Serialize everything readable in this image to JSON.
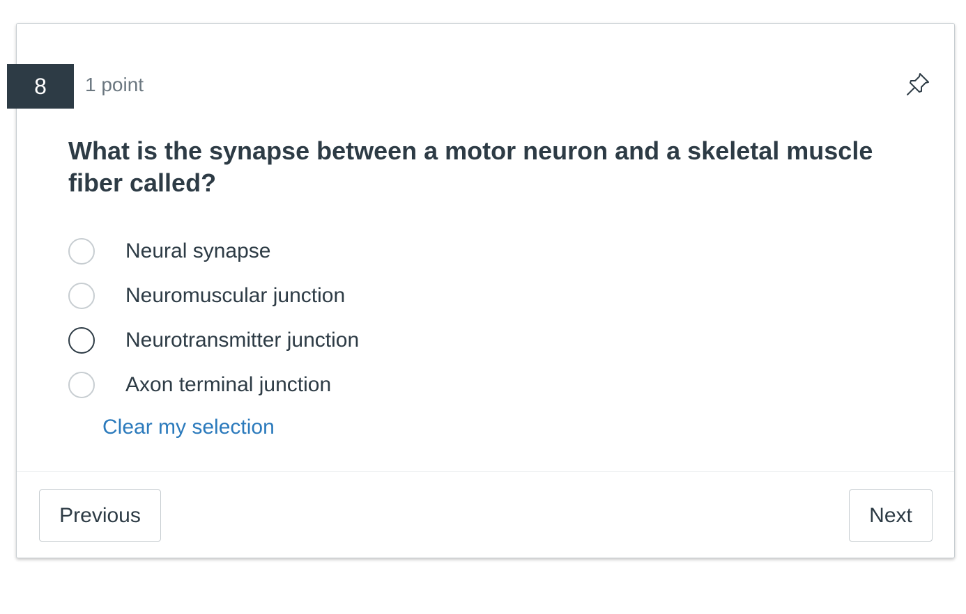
{
  "question": {
    "number": "8",
    "points": "1 point",
    "text": "What is the synapse between a motor neuron and a skeletal muscle fiber called?",
    "pin_icon": "pushpin-icon"
  },
  "options": [
    {
      "label": "Neural synapse",
      "selected": false
    },
    {
      "label": "Neuromuscular junction",
      "selected": false
    },
    {
      "label": "Neurotransmitter junction",
      "selected": false,
      "focused": true
    },
    {
      "label": "Axon terminal junction",
      "selected": false
    }
  ],
  "clear_selection_label": "Clear my selection",
  "navigation": {
    "previous_label": "Previous",
    "next_label": "Next"
  },
  "colors": {
    "header_bg": "#2d3b45",
    "text": "#2d3b45",
    "muted_text": "#6b7780",
    "link": "#2b7abc",
    "border": "#c7cdd1"
  }
}
